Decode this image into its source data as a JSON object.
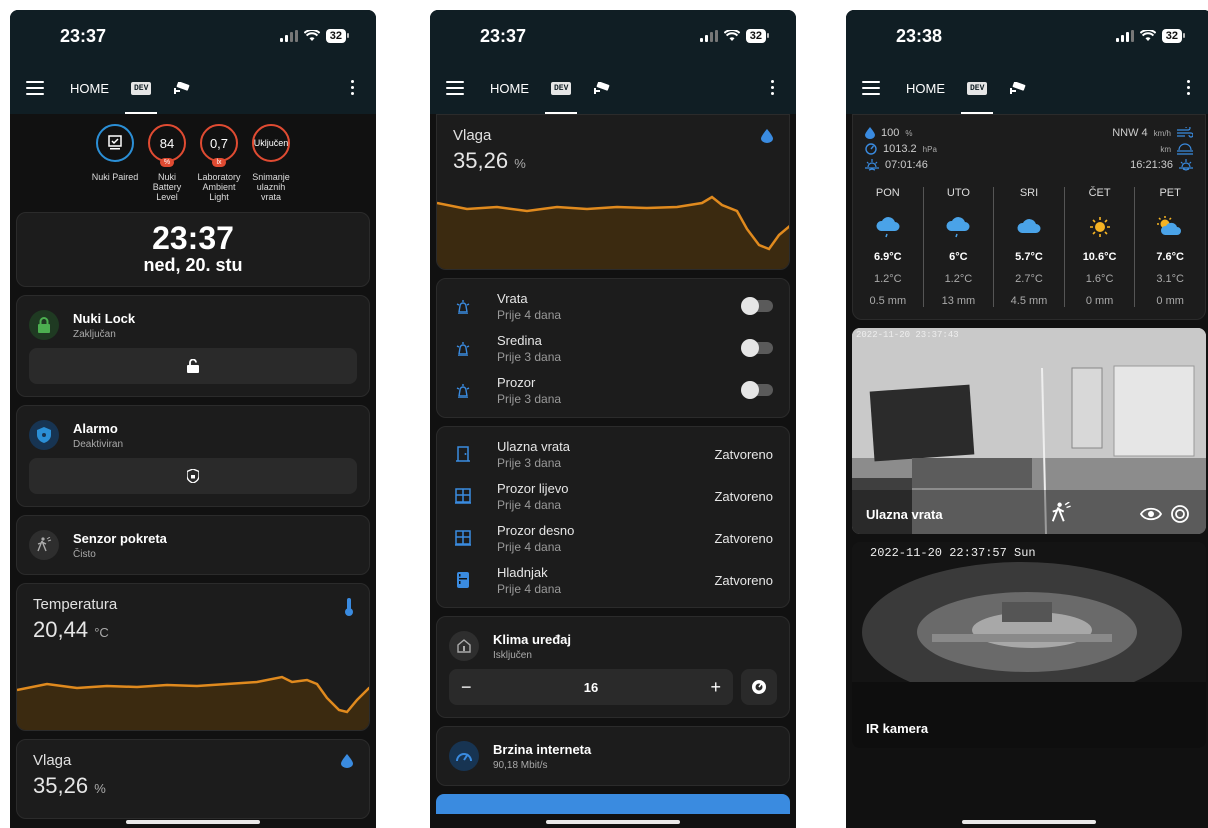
{
  "phone1": {
    "status": {
      "time": "23:37",
      "battery": "32"
    },
    "tabs": {
      "home": "HOME",
      "dev": "DEV"
    },
    "badges": [
      {
        "value": "",
        "label": "Nuki Paired",
        "unit": ""
      },
      {
        "value": "84",
        "label": "Nuki Battery Level",
        "unit": "%"
      },
      {
        "value": "0,7",
        "label": "Laboratory Ambient Light",
        "unit": "lx"
      },
      {
        "value": "Uključen",
        "label": "Snimanje ulaznih vrata",
        "unit": ""
      }
    ],
    "clock": {
      "time": "23:37",
      "date": "ned, 20. stu"
    },
    "lock": {
      "name": "Nuki Lock",
      "state": "Zaključan"
    },
    "alarm": {
      "name": "Alarmo",
      "state": "Deaktiviran"
    },
    "motion": {
      "name": "Senzor pokreta",
      "state": "Čisto"
    },
    "temperature": {
      "title": "Temperatura",
      "value": "20,44",
      "unit": "°C"
    },
    "humidity": {
      "title": "Vlaga",
      "value": "35,26",
      "unit": "%"
    }
  },
  "phone2": {
    "status": {
      "time": "23:37",
      "battery": "32"
    },
    "tabs": {
      "home": "HOME",
      "dev": "DEV"
    },
    "humidity": {
      "title": "Vlaga",
      "value": "35,26",
      "unit": "%"
    },
    "switches": [
      {
        "name": "Vrata",
        "sub": "Prije 4 dana"
      },
      {
        "name": "Sredina",
        "sub": "Prije 3 dana"
      },
      {
        "name": "Prozor",
        "sub": "Prije 3 dana"
      }
    ],
    "sensors": [
      {
        "name": "Ulazna vrata",
        "sub": "Prije 3 dana",
        "state": "Zatvoreno"
      },
      {
        "name": "Prozor lijevo",
        "sub": "Prije 4 dana",
        "state": "Zatvoreno"
      },
      {
        "name": "Prozor desno",
        "sub": "Prije 4 dana",
        "state": "Zatvoreno"
      },
      {
        "name": "Hladnjak",
        "sub": "Prije 4 dana",
        "state": "Zatvoreno"
      }
    ],
    "climate": {
      "name": "Klima uređaj",
      "state": "Isključen",
      "target": "16",
      "minus": "−",
      "plus": "+"
    },
    "internet": {
      "name": "Brzina interneta",
      "state": "90,18 Mbit/s"
    }
  },
  "phone3": {
    "status": {
      "time": "23:38",
      "battery": "32"
    },
    "tabs": {
      "home": "HOME",
      "dev": "DEV"
    },
    "weather": {
      "humidity": "100",
      "humidity_unit": "%",
      "pressure": "1013.2",
      "pressure_unit": "hPa",
      "sunrise": "07:01:46",
      "wind": "NNW 4",
      "wind_unit": "km/h",
      "visibility_unit": "km",
      "sunset": "16:21:36"
    },
    "forecast": [
      {
        "day": "PON",
        "icon": "rain-cloud-icon",
        "hi": "6.9°C",
        "lo": "1.2°C",
        "precip": "0.5 mm"
      },
      {
        "day": "UTO",
        "icon": "rain-cloud-icon",
        "hi": "6°C",
        "lo": "1.2°C",
        "precip": "13 mm"
      },
      {
        "day": "SRI",
        "icon": "cloud-icon",
        "hi": "5.7°C",
        "lo": "2.7°C",
        "precip": "4.5 mm"
      },
      {
        "day": "ČET",
        "icon": "sun-icon",
        "hi": "10.6°C",
        "lo": "1.6°C",
        "precip": "0 mm"
      },
      {
        "day": "PET",
        "icon": "partly-cloudy-icon",
        "hi": "7.6°C",
        "lo": "3.1°C",
        "precip": "0 mm"
      }
    ],
    "camera1": {
      "stamp": "2022-11-20 23:37:43",
      "name": "Ulazna vrata"
    },
    "camera2": {
      "stamp": "2022-11-20 22:37:57 Sun",
      "name": "IR kamera"
    }
  }
}
